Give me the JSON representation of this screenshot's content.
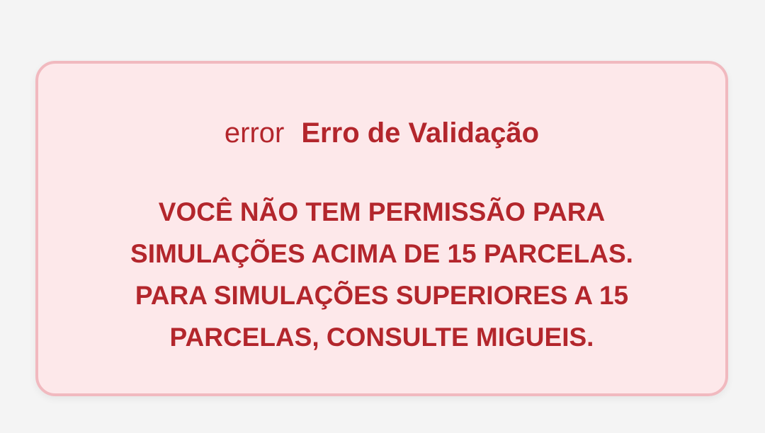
{
  "alert": {
    "icon": "error",
    "icon_name": "error-icon",
    "title": "Erro de Validação",
    "message_lines": [
      "VOCÊ NÃO TEM PERMISSÃO PARA",
      "SIMULAÇÕES ACIMA DE 15 PARCELAS.",
      "PARA SIMULAÇÕES SUPERIORES A 15",
      "PARCELAS, CONSULTE MIGUEIS."
    ]
  },
  "colors": {
    "background": "#f4f4f4",
    "alert_bg": "#fde8ea",
    "alert_border": "#f1b9bf",
    "text": "#b3262c"
  }
}
